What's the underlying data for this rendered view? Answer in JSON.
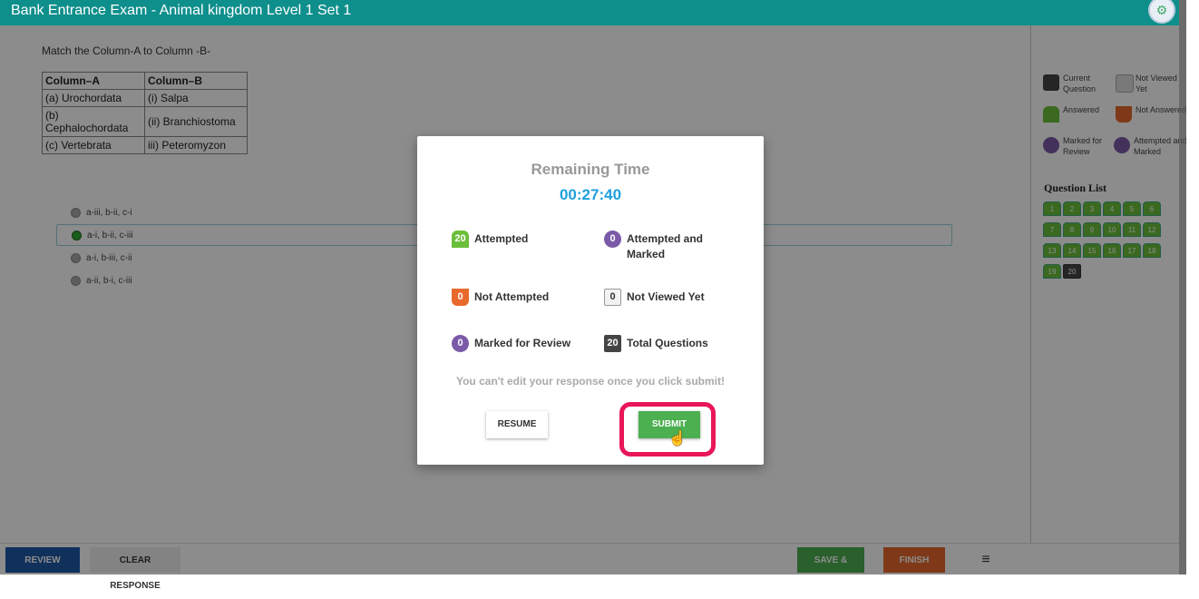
{
  "header": {
    "title": "Bank Entrance Exam - Animal kingdom Level 1 Set 1",
    "settings_icon": "gear-icon"
  },
  "question": {
    "text": "Match the Column-A to Column -B-",
    "table": {
      "headers": [
        "Column–A",
        "Column–B"
      ],
      "rows": [
        [
          "(a) Urochordata",
          "(i) Salpa"
        ],
        [
          "(b) Cephalochordata",
          "(ii) Branchiostoma"
        ],
        [
          "(c) Vertebrata",
          "iii) Peteromyzon"
        ]
      ]
    },
    "options": [
      "a-iii, b-ii, c-i",
      "a-i, b-ii, c-iii",
      "a-i, b-iii, c-ii",
      "a-ii, b-i, c-iii"
    ],
    "selected_option_index": 1
  },
  "legend": {
    "current": "Current Question",
    "not_viewed": "Not Viewed Yet",
    "answered": "Answered",
    "not_answered": "Not Answered",
    "marked": "Marked for Review",
    "attempted_marked": "Attempted and Marked"
  },
  "question_list": {
    "title": "Question List",
    "numbers": [
      "1",
      "2",
      "3",
      "4",
      "5",
      "6",
      "7",
      "8",
      "9",
      "10",
      "11",
      "12",
      "13",
      "14",
      "15",
      "16",
      "17",
      "18",
      "19",
      "20"
    ],
    "current": "20"
  },
  "bottom": {
    "review_later": "REVIEW LATER",
    "clear_response": "CLEAR RESPONSE",
    "save_next": "SAVE & NEXT",
    "finish": "FINISH",
    "menu_icon": "≡"
  },
  "modal": {
    "title": "Remaining Time",
    "time": "00:27:40",
    "attempted_count": "20",
    "attempted_label": "Attempted",
    "att_marked_count": "0",
    "att_marked_label": "Attempted and Marked",
    "not_attempted_count": "0",
    "not_attempted_label": "Not Attempted",
    "not_viewed_count": "0",
    "not_viewed_label": "Not Viewed Yet",
    "marked_count": "0",
    "marked_label": "Marked for Review",
    "total_count": "20",
    "total_label": "Total Questions",
    "warning": "You can't edit your response once you click submit!",
    "resume": "RESUME",
    "submit": "SUBMIT"
  },
  "colors": {
    "accent": "#0e8f8c",
    "submit": "#4caf50",
    "finish": "#e8692c",
    "review_later": "#1e5aa8",
    "timer": "#1ea0e0",
    "highlight": "#e9165a"
  }
}
